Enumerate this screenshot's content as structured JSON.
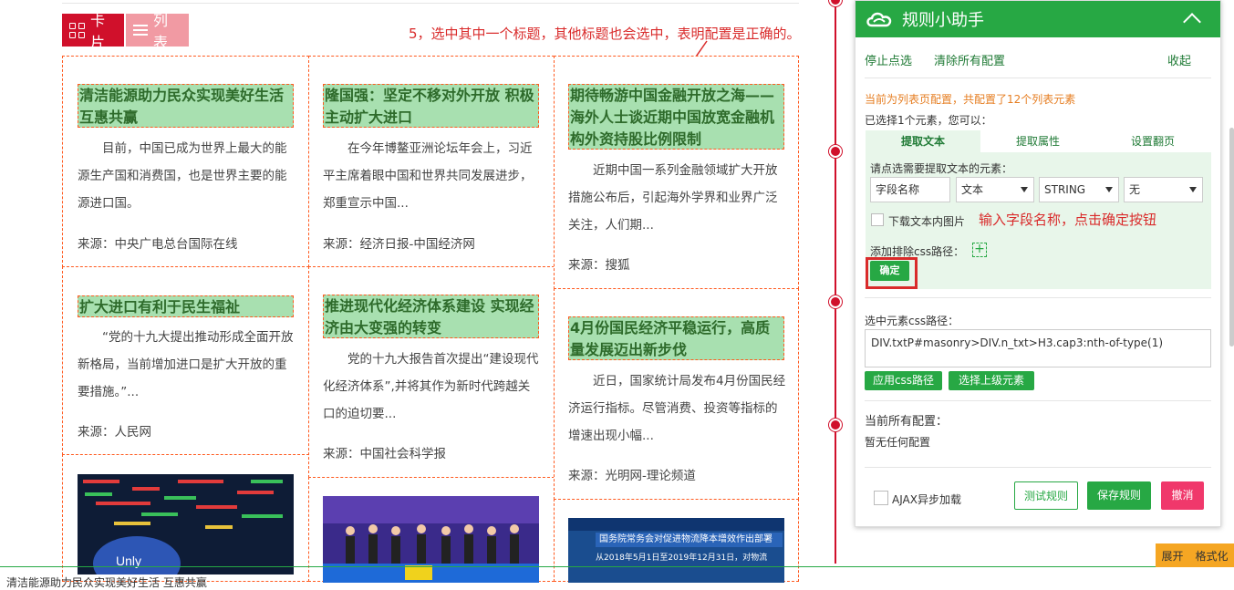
{
  "view_tabs": {
    "card": "卡片",
    "list": "列表"
  },
  "annotations": {
    "top_note": "5，选中其中一个标题，其他标题也会选中，表明配置是正确的。",
    "field_note": "输入字段名称，点击确定按钮"
  },
  "articles": [
    {
      "title": "清洁能源助力民众实现美好生活 互惠共赢",
      "body": "目前，中国已成为世界上最大的能源生产国和消费国，也是世界主要的能源进口国。",
      "source": "来源：中央广电总台国际在线"
    },
    {
      "title": "隆国强：坚定不移对外开放 积极主动扩大进口",
      "body": "在今年博鳌亚洲论坛年会上，习近平主席着眼中国和世界共同发展进步，郑重宣示中国...",
      "source": "来源：经济日报-中国经济网"
    },
    {
      "title": "期待畅游中国金融开放之海——海外人士谈近期中国放宽金融机构外资持股比例限制",
      "body": "近期中国一系列金融领域扩大开放措施公布后，引起海外学界和业界广泛关注，人们期...",
      "source": "来源：搜狐"
    },
    {
      "title": "扩大进口有利于民生福祉",
      "body": "“党的十九大提出推动形成全面开放新格局，当前增加进口是扩大开放的重要措施。”...",
      "source": "来源：人民网"
    },
    {
      "title": "推进现代化经济体系建设 实现经济由大变强的转变",
      "body": "党的十九大报告首次提出“建设现代化经济体系”,并将其作为新时代跨越关口的迫切要...",
      "source": "来源：中国社会科学报"
    },
    {
      "title": "4月份国民经济平稳运行，高质量发展迈出新步伐",
      "body": "近日，国家统计局发布4月份国民经济运行指标。尽管消费、投资等指标的增速出现小幅...",
      "source": "来源：光明网-理论频道"
    }
  ],
  "image_captions": {
    "img3_banner": "国务院常务会对促进物流降本增效作出部署",
    "img3_sub": "从2018年5月1日至2019年12月31日，对物流"
  },
  "panel": {
    "title": "规则小助手",
    "links": {
      "stop": "停止点选",
      "clear": "清除所有配置",
      "collapse": "收起"
    },
    "config_note": "当前为列表页配置，共配置了12个列表元素",
    "selected_note": "已选择1个元素，您可以：",
    "tabs": [
      "提取文本",
      "提取属性",
      "设置翻页"
    ],
    "prompt": "请点选需要提取文本的元素：",
    "field_placeholder": "字段名称",
    "selects": [
      "文本",
      "STRING",
      "无"
    ],
    "download_images": "下载文本内图片",
    "exclude_css": "添加排除css路径：",
    "plus": "+",
    "confirm": "确定",
    "css_label": "选中元素css路径：",
    "css_path": "DIV.txtP#masonry>DIV.n_txt>H3.cap3:nth-of-type(1)",
    "apply_css": "应用css路径",
    "select_parent": "选择上级元素",
    "all_configs_label": "当前所有配置：",
    "no_config": "暂无任何配置",
    "ajax": "AJAX异步加载",
    "test_rule": "测试规则",
    "save_rule": "保存规则",
    "cancel": "撤消"
  },
  "bottom": {
    "status_text": "清洁能源助力民众实现美好生活 互惠共赢",
    "expand": "展开",
    "format": "格式化"
  },
  "colors": {
    "green": "#27a844",
    "red": "#d0102b",
    "highlight": "#a8e0b0",
    "dash": "#ff5a1f"
  }
}
